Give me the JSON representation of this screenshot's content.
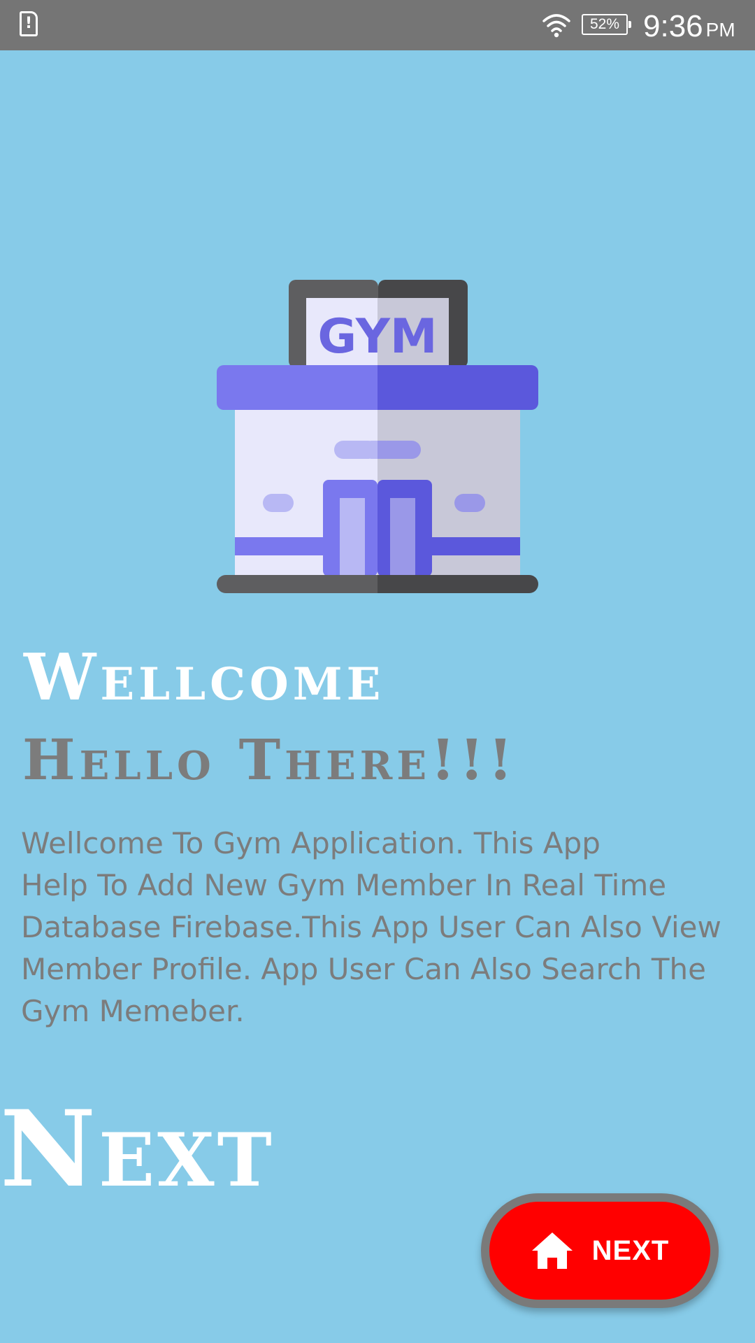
{
  "status_bar": {
    "sim_alert_icon": "sim-alert-icon",
    "wifi_icon": "wifi-icon",
    "battery_level": "52%",
    "time": "9:36",
    "ampm": "PM"
  },
  "illustration": {
    "icon": "gym-building-icon",
    "sign_text": "GYM"
  },
  "welcome_title": "Wellcome",
  "hello_title": "Hello There!!!",
  "description": "Wellcome To Gym Application. This App\nHelp To Add New Gym Member In Real Time\nDatabase Firebase.This App User Can Also  View\nMember Profile.  App User Can Also Search The\nGym Memeber.",
  "next_heading": "Next",
  "next_button": {
    "label": "NEXT",
    "icon": "home-icon"
  },
  "colors": {
    "background": "#87CBE8",
    "status_bar": "#757575",
    "button": "#FF0000",
    "button_border": "#7A7A7A",
    "text_gray": "#7C7C7C",
    "text_white": "#FFFFFF"
  }
}
